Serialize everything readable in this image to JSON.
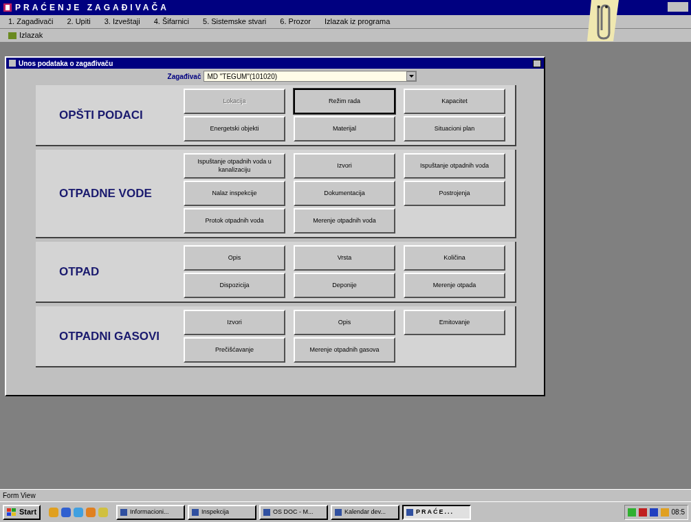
{
  "window": {
    "title": "PRAĆENJE ZAGAĐIVAČA"
  },
  "menu": [
    {
      "label": "1. Zagađivači"
    },
    {
      "label": "2. Upiti"
    },
    {
      "label": "3. Izveštaji"
    },
    {
      "label": "4. Šifarnici"
    },
    {
      "label": "5. Sistemske stvari"
    },
    {
      "label": "6. Prozor"
    },
    {
      "label": "Izlazak iz programa"
    }
  ],
  "toolbar": [
    {
      "label": "Izlazak"
    }
  ],
  "form": {
    "title": "Unos podataka o zagađivaču",
    "field_label": "Zagađivač",
    "field_value": "MD \"TEGUM\"(101020)",
    "sections": [
      {
        "title": "OPŠTI PODACI",
        "buttons": [
          {
            "label": "Lokacija",
            "disabled": true,
            "focused": false
          },
          {
            "label": "Režim rada",
            "disabled": false,
            "focused": true
          },
          {
            "label": "Kapacitet",
            "disabled": false,
            "focused": false
          },
          {
            "label": "Energetski objekti",
            "disabled": false,
            "focused": false
          },
          {
            "label": "Materijal",
            "disabled": false,
            "focused": false
          },
          {
            "label": "Situacioni plan",
            "disabled": false,
            "focused": false
          }
        ]
      },
      {
        "title": "OTPADNE VODE",
        "buttons": [
          {
            "label": "Ispuštanje otpadnih voda u kanalizaciju",
            "disabled": false,
            "focused": false
          },
          {
            "label": "Izvori",
            "disabled": false,
            "focused": false
          },
          {
            "label": "Ispuštanje otpadnih voda",
            "disabled": false,
            "focused": false
          },
          {
            "label": "Nalaz inspekcije",
            "disabled": false,
            "focused": false
          },
          {
            "label": "Dokumentacija",
            "disabled": false,
            "focused": false
          },
          {
            "label": "Postrojenja",
            "disabled": false,
            "focused": false
          },
          {
            "label": "Protok otpadnih voda",
            "disabled": false,
            "focused": false
          },
          {
            "label": "Merenje otpadnih voda",
            "disabled": false,
            "focused": false
          }
        ]
      },
      {
        "title": "OTPAD",
        "buttons": [
          {
            "label": "Opis",
            "disabled": false,
            "focused": false
          },
          {
            "label": "Vrsta",
            "disabled": false,
            "focused": false
          },
          {
            "label": "Količina",
            "disabled": false,
            "focused": false
          },
          {
            "label": "Dispozicija",
            "disabled": false,
            "focused": false
          },
          {
            "label": "Deponije",
            "disabled": false,
            "focused": false
          },
          {
            "label": "Merenje otpada",
            "disabled": false,
            "focused": false
          }
        ]
      },
      {
        "title": "OTPADNI GASOVI",
        "buttons": [
          {
            "label": "Izvori",
            "disabled": false,
            "focused": false
          },
          {
            "label": "Opis",
            "disabled": false,
            "focused": false
          },
          {
            "label": "Emitovanje",
            "disabled": false,
            "focused": false
          },
          {
            "label": "Prečišćavanje",
            "disabled": false,
            "focused": false
          },
          {
            "label": "Merenje otpadnih gasova",
            "disabled": false,
            "focused": false
          }
        ]
      }
    ]
  },
  "status_bar": {
    "text": "Form View"
  },
  "taskbar": {
    "start": "Start",
    "tasks": [
      {
        "label": "Informacioni...",
        "selected": false
      },
      {
        "label": "Inspekcija",
        "selected": false
      },
      {
        "label": "OS DOC - M...",
        "selected": false
      },
      {
        "label": "Kalendar dev...",
        "selected": false
      },
      {
        "label": "PRAĆE...",
        "selected": true
      }
    ],
    "clock": "08:5"
  }
}
